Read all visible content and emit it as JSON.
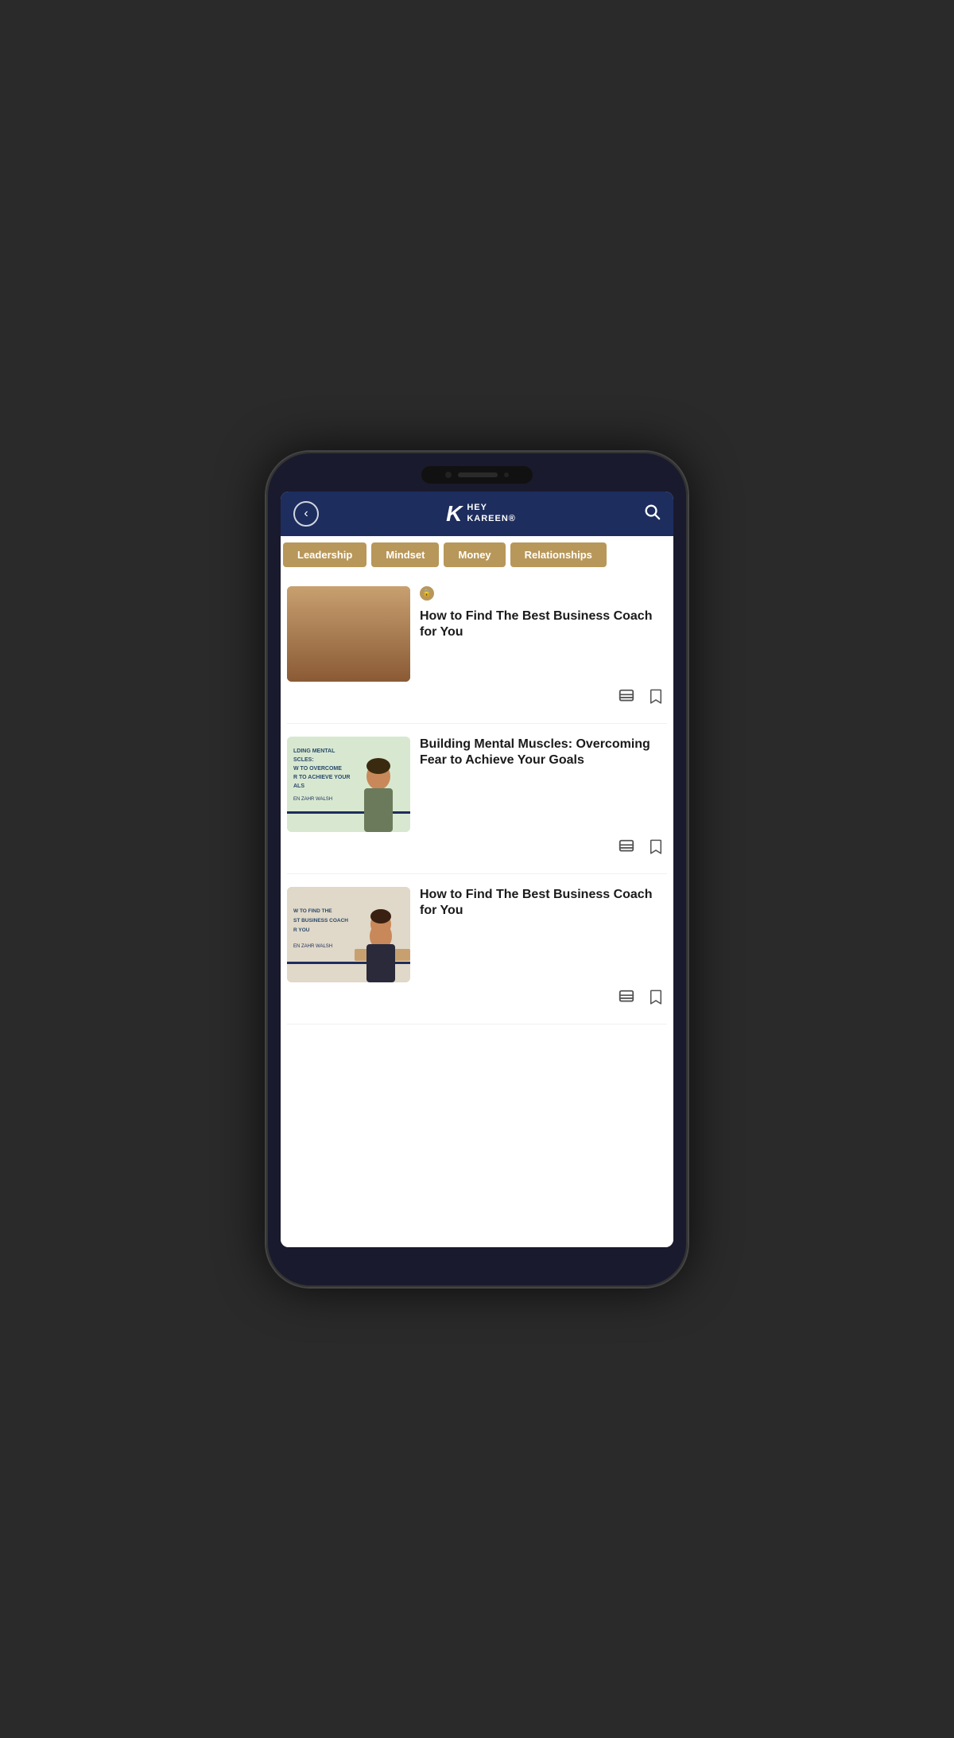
{
  "phone": {
    "header": {
      "back_label": "‹",
      "logo_k": "K",
      "logo_line1": "HEY",
      "logo_line2": "KAREEN®",
      "search_icon": "search"
    },
    "tabs": [
      {
        "id": "leadership",
        "label": "Leadership"
      },
      {
        "id": "mindset",
        "label": "Mindset"
      },
      {
        "id": "money",
        "label": "Money"
      },
      {
        "id": "relationships",
        "label": "Relationships"
      }
    ],
    "articles": [
      {
        "id": "article-1",
        "has_badge": true,
        "badge_icon": "🔒",
        "title": "How to Find The Best Business Coach for You",
        "thumb_type": "person-phone",
        "comment_icon": "💬",
        "bookmark_icon": "🔖"
      },
      {
        "id": "article-2",
        "has_badge": false,
        "title": "Building Mental Muscles: Overcoming Fear to Achieve Your Goals",
        "thumb_type": "book-overlay",
        "thumb_text": "LDING MENTAL\nSCLES:\nV TO OVERCOME\nR TO ACHIEVE YOUR\nALS",
        "thumb_author": "EN ZAHR WALSH",
        "comment_icon": "💬",
        "bookmark_icon": "🔖"
      },
      {
        "id": "article-3",
        "has_badge": false,
        "title": "How to Find The Best Business Coach for You",
        "thumb_type": "book-overlay-2",
        "thumb_text": "W TO FIND THE\nST BUSINESS COACH\nR YOU",
        "thumb_author": "EN ZAHR WALSH",
        "comment_icon": "💬",
        "bookmark_icon": "🔖"
      }
    ]
  }
}
